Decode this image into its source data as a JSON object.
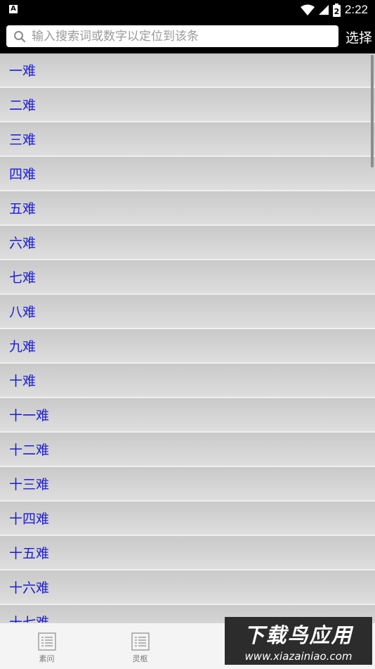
{
  "status": {
    "time": "2:22",
    "left_icon_letter": "A",
    "battery_level": "2",
    "icons": [
      "wifi-icon",
      "signal-icon",
      "battery-icon"
    ]
  },
  "search": {
    "placeholder": "输入搜索词或数字以定位到该条",
    "select_label": "选择"
  },
  "items": [
    "一难",
    "二难",
    "三难",
    "四难",
    "五难",
    "六难",
    "七难",
    "八难",
    "九难",
    "十难",
    "十一难",
    "十二难",
    "十三难",
    "十四难",
    "十五难",
    "十六难",
    "十七难"
  ],
  "tabs": [
    {
      "label": "素问",
      "icon": "list-icon"
    },
    {
      "label": "灵枢",
      "icon": "list-icon"
    },
    {
      "label": "",
      "icon": "list-icon"
    },
    {
      "label": "",
      "icon": "list-icon"
    }
  ],
  "watermark": {
    "title": "下载鸟应用",
    "url": "www.xiazainiao.com"
  },
  "colors": {
    "item_text": "#1c1cd8",
    "item_bg_top": "#c9c9c9",
    "item_bg_bottom": "#dedede",
    "bar_bg": "#000000"
  }
}
